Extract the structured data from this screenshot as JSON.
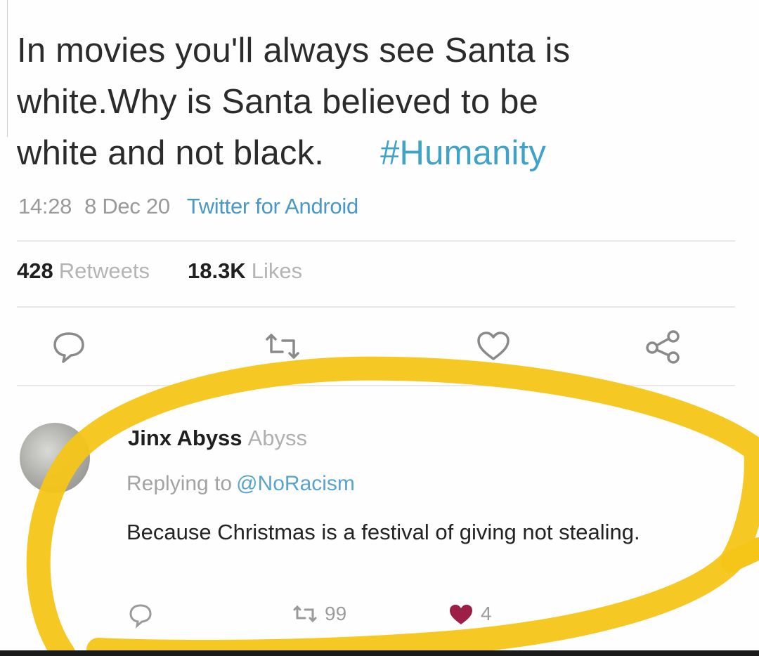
{
  "tweet": {
    "text_lines": [
      "In movies you'll always see Santa is",
      "white.Why is Santa believed to be",
      "white and not black."
    ],
    "hashtag": "#Humanity",
    "time": "14:28",
    "date": "8 Dec 20",
    "source": "Twitter for Android",
    "retweets_count": "428",
    "retweets_label": "Retweets",
    "likes_count": "18.3K",
    "likes_label": "Likes"
  },
  "actions": {
    "icons": [
      "reply-icon",
      "retweet-icon",
      "like-icon",
      "share-icon"
    ]
  },
  "reply": {
    "display_name": "Jinx Abyss",
    "handle": "Abyss",
    "replying_label": "Replying to",
    "replying_to": "@NoRacism",
    "text": "Because Christmas is a festival of giving not stealing.",
    "retweets": "99",
    "likes": "4"
  },
  "colors": {
    "hashtag": "#3fa3c8",
    "link": "#4a98c4",
    "highlight": "#f5c518",
    "like_heart": "#9c1f45"
  }
}
